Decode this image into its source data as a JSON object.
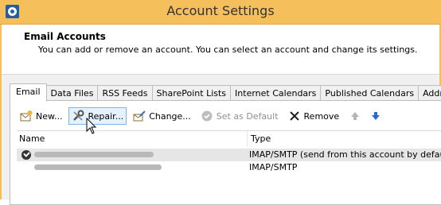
{
  "window": {
    "title": "Account Settings"
  },
  "header": {
    "title": "Email Accounts",
    "description": "You can add or remove an account. You can select an account and change its settings."
  },
  "tabs": [
    {
      "label": "Email",
      "active": true
    },
    {
      "label": "Data Files"
    },
    {
      "label": "RSS Feeds"
    },
    {
      "label": "SharePoint Lists"
    },
    {
      "label": "Internet Calendars"
    },
    {
      "label": "Published Calendars"
    },
    {
      "label": "Address"
    }
  ],
  "toolbar": {
    "new_label": "New...",
    "repair_label": "Repair...",
    "change_label": "Change...",
    "default_label": "Set as Default",
    "remove_label": "Remove"
  },
  "grid": {
    "col_name": "Name",
    "col_type": "Type",
    "rows": [
      {
        "type": "IMAP/SMTP (send from this account by default)",
        "default": true
      },
      {
        "type": "IMAP/SMTP",
        "default": false
      }
    ]
  },
  "colors": {
    "titlebar": "#f5bf5c",
    "selected_row": "#e6e6e6",
    "hover_button": "#e5f1fb"
  }
}
